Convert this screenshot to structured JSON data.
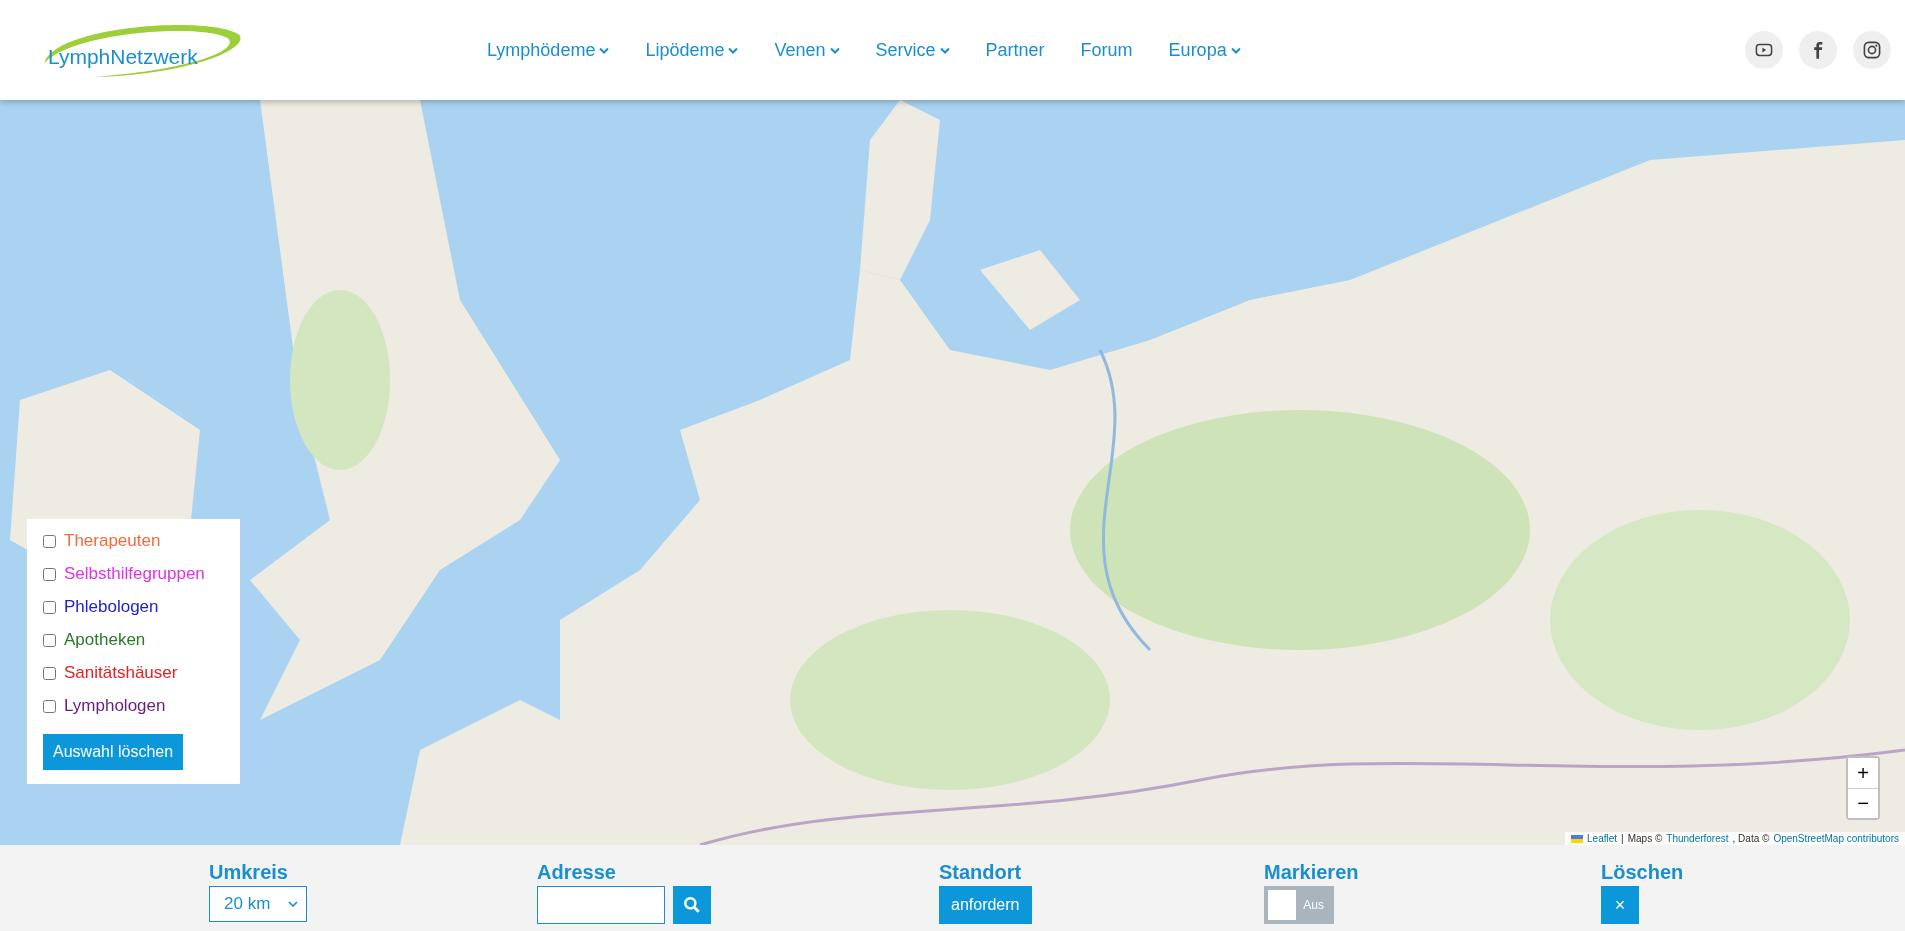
{
  "header": {
    "logo": "LymphNetzwerk",
    "nav": [
      {
        "label": "Lymphödeme",
        "dropdown": true
      },
      {
        "label": "Lipödeme",
        "dropdown": true
      },
      {
        "label": "Venen",
        "dropdown": true
      },
      {
        "label": "Service",
        "dropdown": true
      },
      {
        "label": "Partner",
        "dropdown": false
      },
      {
        "label": "Forum",
        "dropdown": false
      },
      {
        "label": "Europa",
        "dropdown": true
      }
    ],
    "social": [
      {
        "kind": "youtube"
      },
      {
        "kind": "facebook"
      },
      {
        "kind": "instagram"
      }
    ]
  },
  "map": {
    "filters": [
      {
        "label": "Therapeuten",
        "checked": false,
        "color": "#f26b3a"
      },
      {
        "label": "Selbsthilfegruppen",
        "checked": false,
        "color": "#e033e6"
      },
      {
        "label": "Phlebologen",
        "checked": false,
        "color": "#2222cc"
      },
      {
        "label": "Apotheken",
        "checked": false,
        "color": "#2a7a2a"
      },
      {
        "label": "Sanitätshäuser",
        "checked": false,
        "color": "#e02424"
      },
      {
        "label": "Lymphologen",
        "checked": false,
        "color": "#6a1f7a"
      }
    ],
    "clear_button": "Auswahl löschen",
    "zoom": [
      "+",
      "−"
    ],
    "attribution": {
      "leaflet": "Leaflet",
      "sep": "|",
      "maps": "Maps ©",
      "provider": "Thunderforest",
      "data": ", Data ©",
      "osm": "OpenStreetMap contributors"
    }
  },
  "toolbar": {
    "radius": {
      "label": "Umkreis",
      "value": "20 km"
    },
    "address": {
      "label": "Adresse"
    },
    "location": {
      "label": "Standort",
      "button": "anfordern"
    },
    "mark": {
      "label": "Markieren",
      "on": false,
      "state_label": "Aus"
    },
    "delete": {
      "label": "Löschen",
      "button": "×"
    }
  }
}
